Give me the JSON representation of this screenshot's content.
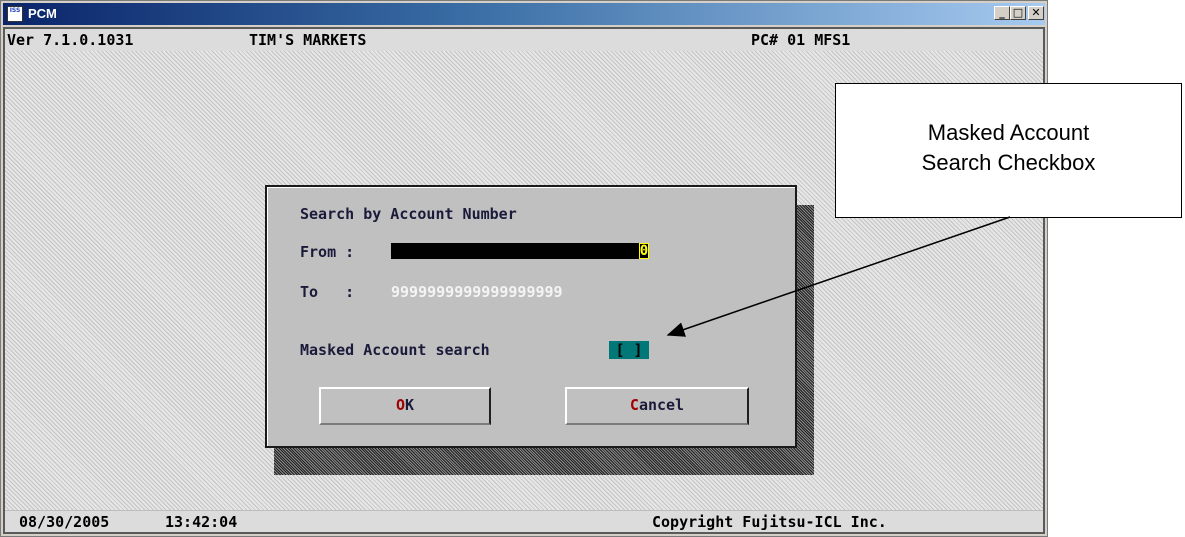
{
  "window": {
    "title": "PCM",
    "icon_name": "app-icon",
    "app_icon_text": "ISS",
    "controls": {
      "minimize": "_",
      "maximize": "□",
      "close": "✕"
    }
  },
  "header": {
    "version": "Ver 7.1.0.1031",
    "store": "TIM'S MARKETS",
    "pc": "PC# 01 MFS1"
  },
  "dialog": {
    "heading": "Search by Account Number",
    "from_label": "From :",
    "from_value": "0",
    "to_label": "To   :",
    "to_value": "9999999999999999999",
    "masked_label": "Masked Account search",
    "masked_checkbox": "[ ]",
    "ok_button": {
      "hotkey": "O",
      "rest": "K"
    },
    "cancel_button": {
      "hotkey": "C",
      "rest": "ancel"
    }
  },
  "footer": {
    "date": "08/30/2005",
    "time": "13:42:04",
    "copyright": "Copyright Fujitsu-ICL Inc."
  },
  "callout": {
    "line1": "Masked Account",
    "line2": "Search Checkbox"
  },
  "colors": {
    "title_gradient_start": "#0a246a",
    "checkbox_bg": "#007878",
    "from_value_fg": "#ffff00",
    "hotkey": "#a00000"
  }
}
